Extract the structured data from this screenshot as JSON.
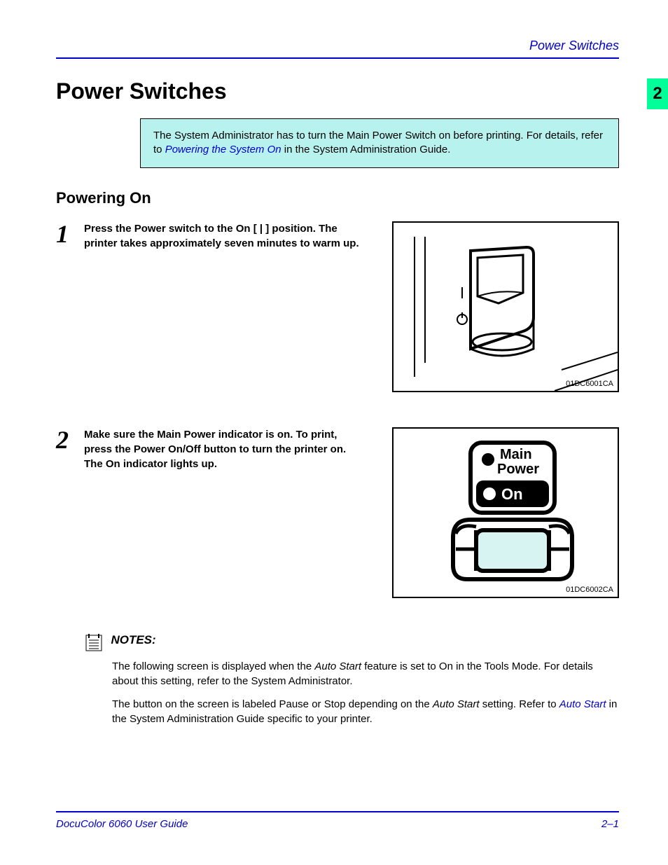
{
  "header": {
    "title": "Power Switches"
  },
  "tab": {
    "label": "2"
  },
  "section": {
    "title": "Power Switches"
  },
  "highlight": {
    "text": "The System Administrator has to turn the Main Power Switch on before printing. For details, refer to ",
    "ref": "Powering the System On",
    "tail": " in the System Administration Guide."
  },
  "sub_heading": "Powering On",
  "steps": [
    {
      "num": "1",
      "text": "Press the Power switch to the On [ | ] position. The printer takes approximately seven minutes to warm up."
    },
    {
      "num": "2",
      "text": "Make sure the Main Power indicator is on. To print, press the Power On/Off button to turn the printer on. The On indicator lights up."
    }
  ],
  "figures": [
    {
      "code": "01DC6001CA"
    },
    {
      "code": "01DC6002CA"
    }
  ],
  "note": {
    "label": "NOTES:",
    "lines": [
      {
        "text": "The following screen is displayed when the ",
        "ital": "Auto Start",
        "tail": " feature is set to On in the Tools Mode. For details about this setting, refer to the System Administrator."
      },
      {
        "text": "The button on the screen is labeled Pause or Stop depending on the ",
        "ital": "Auto Start",
        "tail": " setting. Refer to ",
        "ref": "Auto Start",
        "tail2": " in the System Administration Guide specific to your printer."
      }
    ]
  },
  "footer": {
    "left": "DocuColor 6060 User Guide",
    "right": "2–1"
  },
  "fig2_labels": {
    "main_power": "Main\nPower",
    "on": "On"
  }
}
